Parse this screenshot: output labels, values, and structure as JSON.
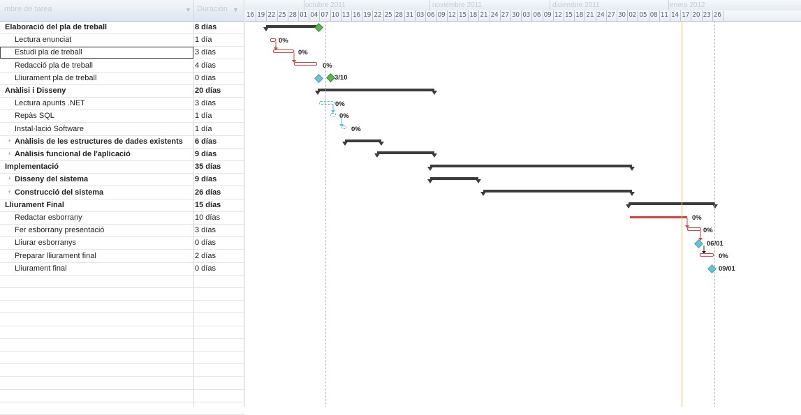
{
  "header": {
    "col_name": "mbre de tarea",
    "col_duration": "Duración",
    "dropdown_glyph": "▼"
  },
  "timeline": {
    "months": [
      {
        "label": "octubre 2011"
      },
      {
        "label": "noviembre 2011"
      },
      {
        "label": "diciembre 2011"
      },
      {
        "label": "enero 2012"
      }
    ],
    "days": [
      "16",
      "19",
      "22",
      "25",
      "28",
      "01",
      "04",
      "07",
      "10",
      "13",
      "16",
      "19",
      "22",
      "25",
      "28",
      "31",
      "03",
      "06",
      "09",
      "12",
      "15",
      "18",
      "21",
      "24",
      "27",
      "30",
      "03",
      "06",
      "09",
      "12",
      "15",
      "18",
      "21",
      "24",
      "27",
      "30",
      "02",
      "05",
      "08",
      "11",
      "14",
      "17",
      "20",
      "23",
      "26"
    ]
  },
  "tasks": [
    {
      "name": "Elaboració del pla de treball",
      "duration": "8 días",
      "summary": true,
      "level": 0
    },
    {
      "name": "Lectura enunciat",
      "duration": "1 día",
      "summary": false,
      "level": 1
    },
    {
      "name": "Estudi pla de treball",
      "duration": "3 días",
      "summary": false,
      "level": 1,
      "selected": true
    },
    {
      "name": "Redacció pla de treball",
      "duration": "4 días",
      "summary": false,
      "level": 1
    },
    {
      "name": "Lliurament pla de treball",
      "duration": "0 días",
      "summary": false,
      "level": 1
    },
    {
      "name": "Anàlisi i Disseny",
      "duration": "20 días",
      "summary": true,
      "level": 0
    },
    {
      "name": "Lectura apunts .NET",
      "duration": "3 días",
      "summary": false,
      "level": 1
    },
    {
      "name": "Repàs SQL",
      "duration": "1 día",
      "summary": false,
      "level": 1
    },
    {
      "name": "Instal·lació Software",
      "duration": "1 día",
      "summary": false,
      "level": 1
    },
    {
      "name": "Anàlisis de les estructures de dades existents",
      "duration": "6 días",
      "summary": true,
      "level": 1,
      "expander": "+"
    },
    {
      "name": "Anàlisis funcional de l'aplicació",
      "duration": "9 días",
      "summary": true,
      "level": 1,
      "expander": "+"
    },
    {
      "name": "Implementació",
      "duration": "35 días",
      "summary": true,
      "level": 0
    },
    {
      "name": "Disseny del sistema",
      "duration": "9 días",
      "summary": true,
      "level": 1,
      "expander": "+"
    },
    {
      "name": "Construcció del sistema",
      "duration": "26 días",
      "summary": true,
      "level": 1,
      "expander": "+"
    },
    {
      "name": "Lliurament Final",
      "duration": "15 días",
      "summary": true,
      "level": 0
    },
    {
      "name": "Redactar esborrany",
      "duration": "10 días",
      "summary": false,
      "level": 1
    },
    {
      "name": "Fer esborrany presentació",
      "duration": "3 días",
      "summary": false,
      "level": 1
    },
    {
      "name": "Lliurar esborranys",
      "duration": "0 días",
      "summary": false,
      "level": 1
    },
    {
      "name": "Preparar lliurament final",
      "duration": "2 días",
      "summary": false,
      "level": 1
    },
    {
      "name": "Lliurament final",
      "duration": "0 días",
      "summary": false,
      "level": 1
    }
  ],
  "bar_labels": {
    "lectura_enunciat": "0%",
    "estudi_pla": "0%",
    "redaccio_pla": "0%",
    "lliurament_pla": "3/10",
    "lectura_net": "0%",
    "repas_sql": "0%",
    "installacio": "0%",
    "redactar_esborrany": "0%",
    "fer_presentacio": "0%",
    "lliurar_esborranys": "06/01",
    "preparar_final": "0%",
    "lliurament_final": "09/01"
  },
  "colors": {
    "summary_bar": "#3c3c3c",
    "critical_task": "#e83a3a",
    "normal_task": "#4cc3d6",
    "milestone": "#5ec7db",
    "status_line": "#f3c49a"
  }
}
